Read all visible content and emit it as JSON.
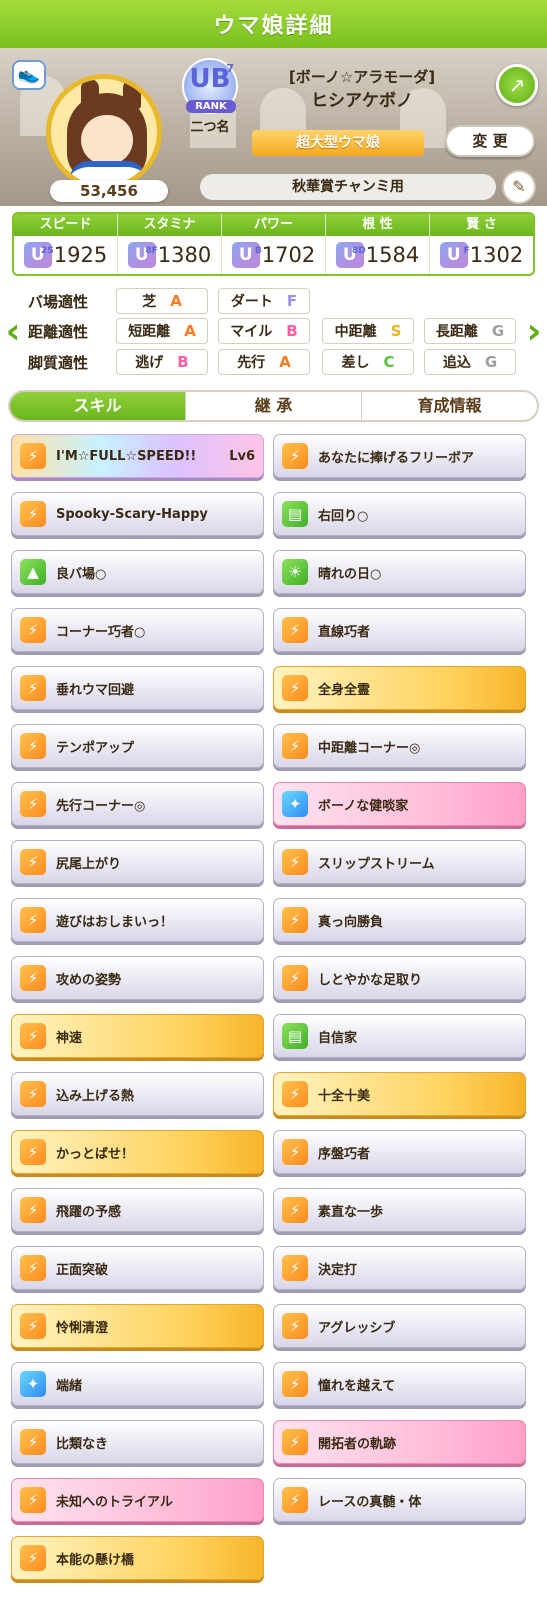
{
  "header": {
    "title": "ウマ娘詳細"
  },
  "profile": {
    "fans": "53,456",
    "rank_letter": "UB",
    "rank_sup": "7",
    "rank_label": "RANK",
    "nickname": "二つ名",
    "epithet": "[ボーノ☆アラモーダ]",
    "name": "ヒシアケボノ",
    "grade": "超大型ウマ娘",
    "change_label": "変 更",
    "subtitle": "秋華賞チャンミ用",
    "icons": {
      "share": "share-icon",
      "edit": "pencil-icon",
      "shoe": "shoe-icon"
    }
  },
  "stats": [
    {
      "label": "スピード",
      "grade": "U",
      "grade_sup": "2S",
      "value": "1925"
    },
    {
      "label": "スタミナ",
      "grade": "U",
      "grade_sup": "8F",
      "value": "1380"
    },
    {
      "label": "パワー",
      "grade": "U",
      "grade_sup": "B",
      "value": "1702"
    },
    {
      "label": "根 性",
      "grade": "U",
      "grade_sup": "8D",
      "value": "1584"
    },
    {
      "label": "賢 さ",
      "grade": "U",
      "grade_sup": "F",
      "value": "1302"
    }
  ],
  "aptitude": {
    "track": {
      "label": "バ場適性",
      "items": [
        {
          "name": "芝",
          "grade": "A"
        },
        {
          "name": "ダート",
          "grade": "F"
        }
      ]
    },
    "distance": {
      "label": "距離適性",
      "items": [
        {
          "name": "短距離",
          "grade": "A"
        },
        {
          "name": "マイル",
          "grade": "B"
        },
        {
          "name": "中距離",
          "grade": "S"
        },
        {
          "name": "長距離",
          "grade": "G"
        }
      ]
    },
    "style": {
      "label": "脚質適性",
      "items": [
        {
          "name": "逃げ",
          "grade": "B"
        },
        {
          "name": "先行",
          "grade": "A"
        },
        {
          "name": "差し",
          "grade": "C"
        },
        {
          "name": "追込",
          "grade": "G"
        }
      ]
    }
  },
  "grade_colors": {
    "A": "#ff7a1e",
    "B": "#ff5fa2",
    "C": "#5cc03a",
    "S": "#f0b21e",
    "F": "#9a8cf0",
    "G": "#9e9e9e"
  },
  "tabs": [
    {
      "label": "スキル"
    },
    {
      "label": "継 承"
    },
    {
      "label": "育成情報"
    }
  ],
  "skills": {
    "s0": {
      "name": "I'M☆FULL☆SPEED!!",
      "lv": "Lv6"
    },
    "s1": {
      "name": "あなたに捧げるフリーボア"
    },
    "s2": {
      "name": "Spooky-Scary-Happy"
    },
    "s3": {
      "name": "右回り○"
    },
    "s4": {
      "name": "良バ場○"
    },
    "s5": {
      "name": "晴れの日○"
    },
    "s6": {
      "name": "コーナー巧者○"
    },
    "s7": {
      "name": "直線巧者"
    },
    "s8": {
      "name": "垂れウマ回避"
    },
    "s9": {
      "name": "全身全霊"
    },
    "s10": {
      "name": "テンポアップ"
    },
    "s11": {
      "name": "中距離コーナー◎"
    },
    "s12": {
      "name": "先行コーナー◎"
    },
    "s13": {
      "name": "ボーノな健啖家"
    },
    "s14": {
      "name": "尻尾上がり"
    },
    "s15": {
      "name": "スリップストリーム"
    },
    "s16": {
      "name": "遊びはおしまいっ！"
    },
    "s17": {
      "name": "真っ向勝負"
    },
    "s18": {
      "name": "攻めの姿勢"
    },
    "s19": {
      "name": "しとやかな足取り"
    },
    "s20": {
      "name": "神速"
    },
    "s21": {
      "name": "自信家"
    },
    "s22": {
      "name": "込み上げる熱"
    },
    "s23": {
      "name": "十全十美"
    },
    "s24": {
      "name": "かっとばせ！"
    },
    "s25": {
      "name": "序盤巧者"
    },
    "s26": {
      "name": "飛躍の予感"
    },
    "s27": {
      "name": "素直な一歩"
    },
    "s28": {
      "name": "正面突破"
    },
    "s29": {
      "name": "決定打"
    },
    "s30": {
      "name": "怜悧清澄"
    },
    "s31": {
      "name": "アグレッシブ"
    },
    "s32": {
      "name": "端緒"
    },
    "s33": {
      "name": "憧れを越えて"
    },
    "s34": {
      "name": "比類なき"
    },
    "s35": {
      "name": "開拓者の軌跡"
    },
    "s36": {
      "name": "未知へのトライアル"
    },
    "s37": {
      "name": "レースの真髄・体"
    },
    "s38": {
      "name": "本能の懸け橋"
    }
  }
}
